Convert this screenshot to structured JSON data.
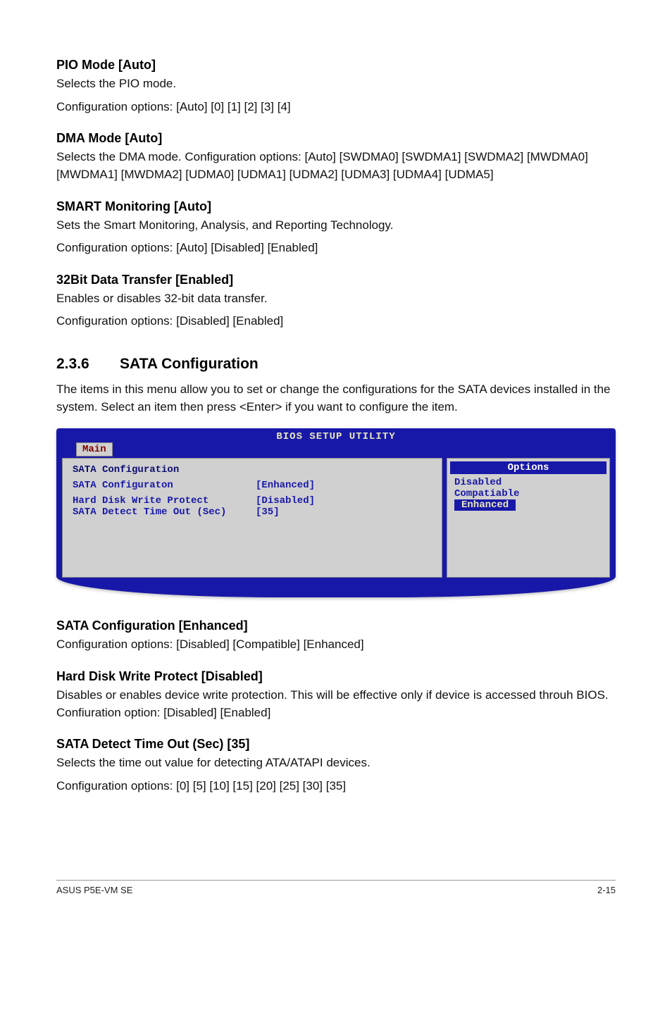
{
  "sections": {
    "pio": {
      "heading": "PIO Mode [Auto]",
      "line1": "Selects the PIO mode.",
      "line2": "Configuration options: [Auto] [0] [1] [2] [3] [4]"
    },
    "dma": {
      "heading": "DMA Mode [Auto]",
      "body": "Selects the DMA mode. Configuration options: [Auto] [SWDMA0] [SWDMA1] [SWDMA2] [MWDMA0] [MWDMA1] [MWDMA2] [UDMA0] [UDMA1] [UDMA2] [UDMA3] [UDMA4] [UDMA5]"
    },
    "smart": {
      "heading": "SMART Monitoring [Auto]",
      "line1": "Sets the Smart Monitoring, Analysis, and Reporting Technology.",
      "line2": "Configuration options: [Auto] [Disabled] [Enabled]"
    },
    "bit32": {
      "heading": "32Bit Data Transfer [Enabled]",
      "line1": "Enables or disables 32-bit data transfer.",
      "line2": "Configuration options: [Disabled] [Enabled]"
    },
    "sata_cfg_section": {
      "num": "2.3.6",
      "title": "SATA Configuration",
      "body": "The items in this menu allow you to set or change the configurations for the SATA devices installed in the system. Select an item then press <Enter> if you want to configure the item."
    },
    "sata_cfg_enh": {
      "heading": "SATA Configuration [Enhanced]",
      "body": "Configuration options: [Disabled] [Compatible] [Enhanced]"
    },
    "hdwp": {
      "heading": "Hard Disk Write Protect [Disabled]",
      "body": "Disables or enables device write protection. This will be effective only if device is accessed throuh BIOS. Confiuration option: [Disabled] [Enabled]"
    },
    "sata_timeout": {
      "heading": "SATA Detect Time Out (Sec) [35]",
      "line1": "Selects the time out value for detecting ATA/ATAPI devices.",
      "line2": "Configuration options: [0] [5] [10] [15] [20] [25] [30] [35]"
    }
  },
  "bios": {
    "title": "BIOS SETUP UTILITY",
    "tab": "Main",
    "panel_header": "SATA Configuration",
    "rows": [
      {
        "label": "SATA Configuraton",
        "value": "[Enhanced]"
      },
      {
        "label": "Hard Disk Write Protect",
        "value": "[Disabled]"
      },
      {
        "label": "SATA Detect Time Out (Sec)",
        "value": "[35]"
      }
    ],
    "options_header": "Options",
    "options": [
      {
        "text": "Disabled",
        "selected": false
      },
      {
        "text": "Compatiable",
        "selected": false
      },
      {
        "text": "Enhanced",
        "selected": true
      }
    ]
  },
  "footer": {
    "left": "ASUS P5E-VM SE",
    "right": "2-15"
  }
}
